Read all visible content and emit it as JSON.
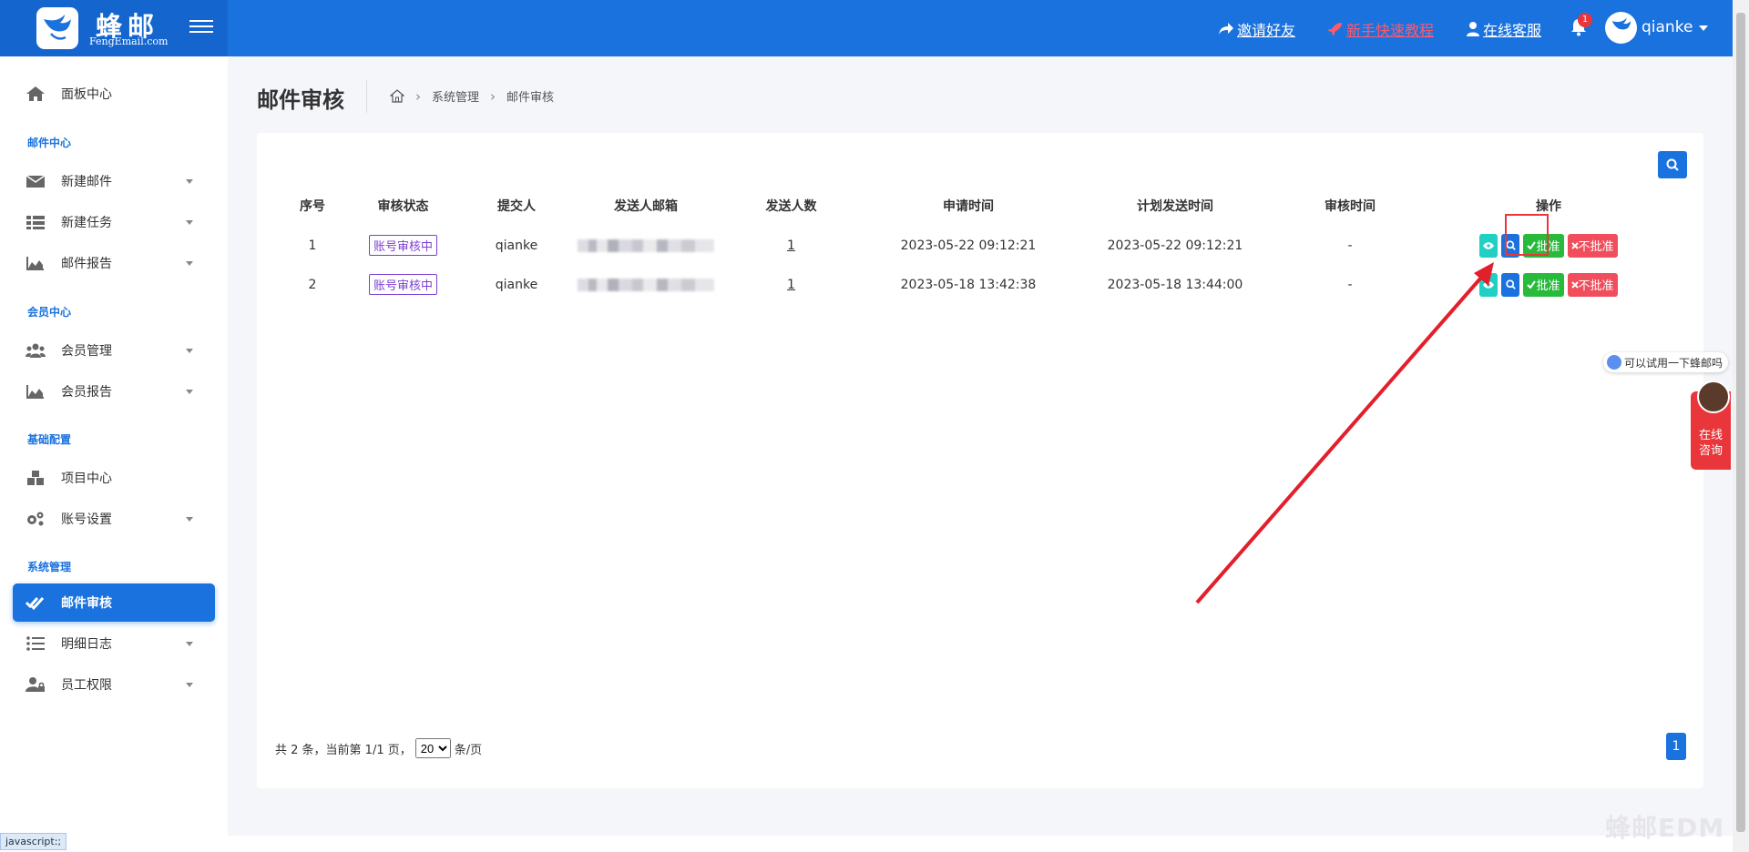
{
  "brand": {
    "name": "蜂邮",
    "domain": "FengEmail.com"
  },
  "header": {
    "invite": "邀请好友",
    "tutorial": "新手快速教程",
    "support": "在线客服",
    "bell_count": "1",
    "user": "qianke"
  },
  "sidebar": {
    "dashboard": "面板中心",
    "section_mail": "邮件中心",
    "new_mail": "新建邮件",
    "new_task": "新建任务",
    "mail_report": "邮件报告",
    "section_member": "会员中心",
    "member_mgmt": "会员管理",
    "member_report": "会员报告",
    "section_base": "基础配置",
    "project_center": "项目中心",
    "account_settings": "账号设置",
    "section_system": "系统管理",
    "mail_review": "邮件审核",
    "detail_log": "明细日志",
    "staff_perm": "员工权限"
  },
  "status_bar": "javascript:;",
  "page": {
    "title": "邮件审核",
    "breadcrumb": [
      "系统管理",
      "邮件审核"
    ]
  },
  "table": {
    "headers": [
      "序号",
      "审核状态",
      "提交人",
      "发送人邮箱",
      "发送人数",
      "申请时间",
      "计划发送时间",
      "审核时间",
      "操作"
    ],
    "rows": [
      {
        "index": "1",
        "status": "账号审核中",
        "submitter": "qianke",
        "count": "1",
        "apply_time": "2023-05-22 09:12:21",
        "send_time": "2023-05-22 09:12:21",
        "review_time": "-"
      },
      {
        "index": "2",
        "status": "账号审核中",
        "submitter": "qianke",
        "count": "1",
        "apply_time": "2023-05-18 13:42:38",
        "send_time": "2023-05-18 13:44:00",
        "review_time": "-"
      }
    ],
    "approve_label": "批准",
    "reject_label": "不批准"
  },
  "pager": {
    "summary": "共 2 条，当前第 1/1 页，",
    "page_size": "20",
    "page_size_suffix": "条/页",
    "current_page": "1"
  },
  "widgets": {
    "trial_text": "可以试用一下蜂邮吗",
    "consult_line1": "在线",
    "consult_line2": "咨询",
    "watermark": "蜂邮EDM"
  },
  "colors": {
    "primary": "#1a72de",
    "approve": "#27ba3b",
    "reject": "#f04e5c",
    "view": "#20d0c4",
    "tag": "#7b3fd3"
  }
}
